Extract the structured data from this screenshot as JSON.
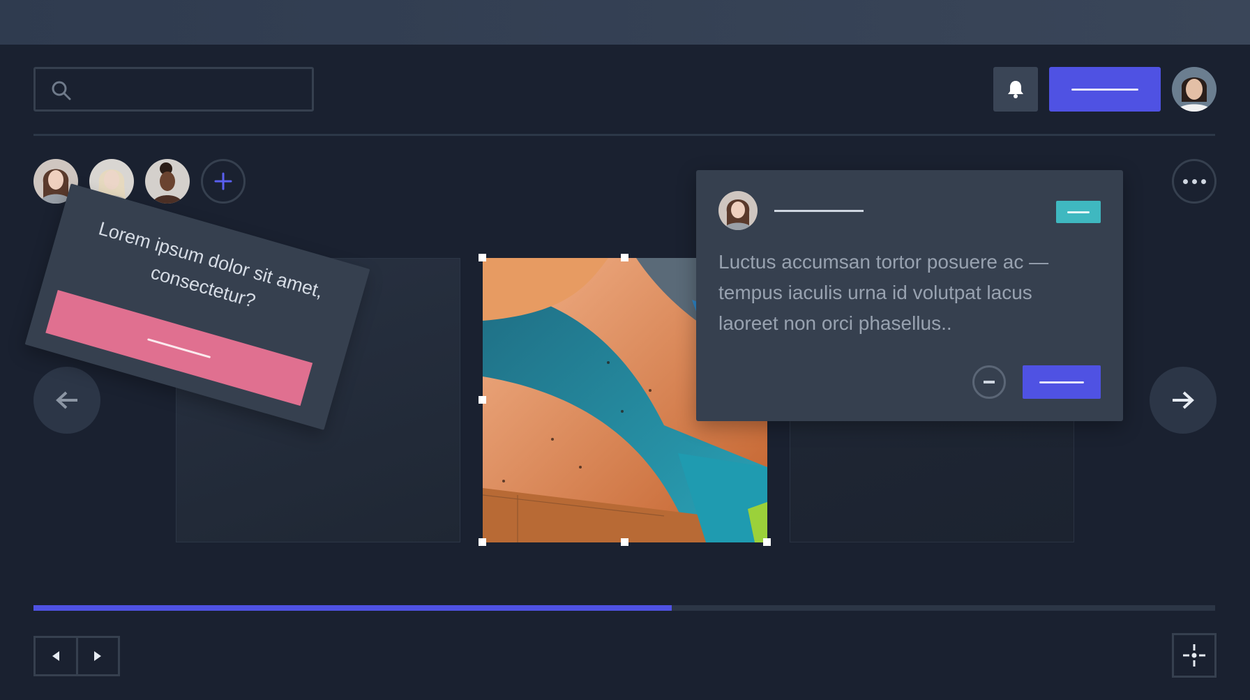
{
  "header": {
    "search": {
      "icon": "search-icon",
      "value": ""
    },
    "notifications": {
      "icon": "bell-icon"
    },
    "profile": {
      "avatar": "user-avatar-woman-dark-hair"
    }
  },
  "collaborators": {
    "avatars": [
      "avatar-woman-turtleneck",
      "avatar-woman-blonde",
      "avatar-woman-curly-hair"
    ],
    "add_icon": "plus-icon",
    "more_icon": "more-horizontal-icon"
  },
  "tilted_card": {
    "text": "Lorem ipsum dolor sit amet, consectetur?",
    "button_color": "#e07090"
  },
  "popover": {
    "text": "Luctus accumsan tortor posuere ac — tempus iaculis urna id volutpat lacus laoreet non orci phasellus..",
    "tag_color": "#3fb8c0",
    "minus_icon": "minus-icon"
  },
  "carousel": {
    "prev_icon": "arrow-left-icon",
    "next_icon": "arrow-right-icon",
    "selected_image": "abstract-metal-facade-photo"
  },
  "progress": {
    "value": 0.54
  },
  "footer": {
    "pager_prev_icon": "triangle-left-icon",
    "pager_next_icon": "triangle-right-icon",
    "crosshair_icon": "crosshair-icon"
  },
  "colors": {
    "background": "#1a2130",
    "accent": "#4f52e3",
    "panel": "#36404f",
    "pink": "#e07090",
    "teal": "#3fb8c0"
  }
}
